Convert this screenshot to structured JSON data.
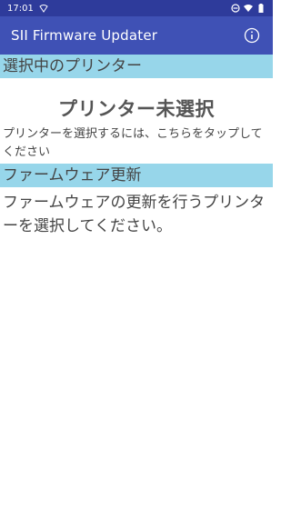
{
  "status_bar": {
    "time": "17:01",
    "icons": [
      "wifi-calling-icon",
      "do-not-disturb-icon",
      "wifi-icon",
      "battery-icon"
    ]
  },
  "app_bar": {
    "title": "SII Firmware Updater",
    "info_icon": "info-icon"
  },
  "selected_printer": {
    "header": "選択中のプリンター",
    "status": "プリンター未選択",
    "hint": "プリンターを選択するには、こちらをタップしてください"
  },
  "firmware_update": {
    "header": "ファームウェア更新",
    "message": "ファームウェアの更新を行うプリンターを選択してください。"
  },
  "colors": {
    "status_bar": "#2e3b9b",
    "app_bar": "#3f51b5",
    "section_header": "#97d6ea"
  }
}
